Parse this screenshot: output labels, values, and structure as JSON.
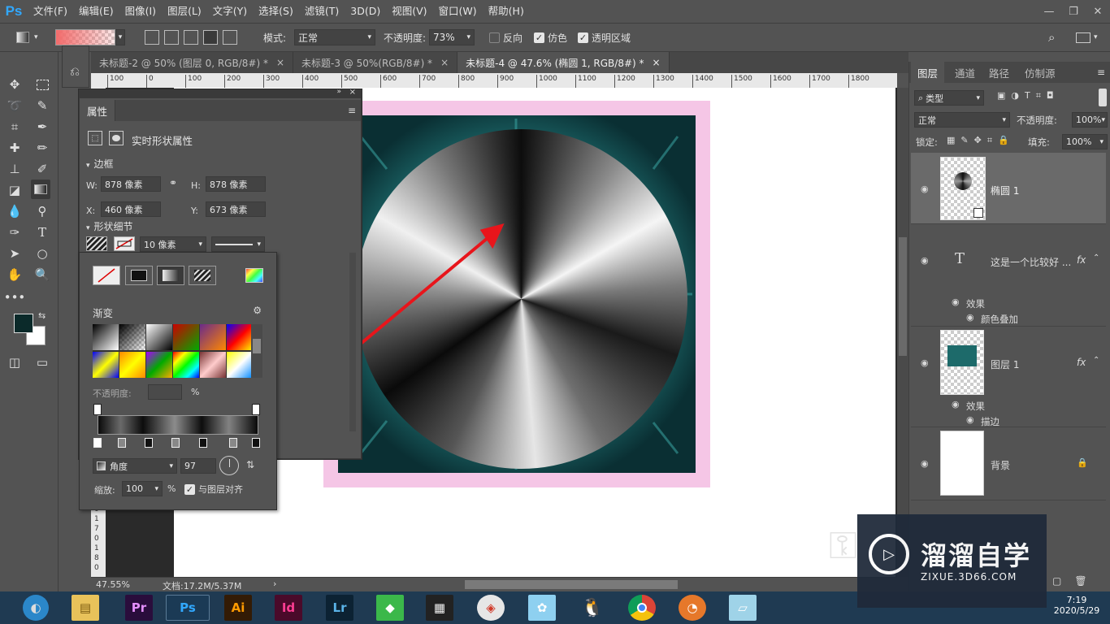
{
  "app": {
    "logo": "Ps"
  },
  "menu": [
    "文件(F)",
    "编辑(E)",
    "图像(I)",
    "图层(L)",
    "文字(Y)",
    "选择(S)",
    "滤镜(T)",
    "3D(D)",
    "视图(V)",
    "窗口(W)",
    "帮助(H)"
  ],
  "window_controls": {
    "minimize": "—",
    "restore": "❐",
    "close": "✕"
  },
  "options": {
    "mode_label": "模式:",
    "mode_value": "正常",
    "opacity_label": "不透明度:",
    "opacity_value": "73%",
    "reverse_label": "反向",
    "dither_label": "仿色",
    "transparency_label": "透明区域",
    "reverse_checked": false,
    "dither_checked": true,
    "transparency_checked": true
  },
  "tabs": [
    {
      "label": "未标题-2 @ 50% (图层 0, RGB/8#) *",
      "active": false
    },
    {
      "label": "未标题-3 @ 50%(RGB/8#) *",
      "active": false
    },
    {
      "label": "未标题-4 @ 47.6% (椭圆 1, RGB/8#) *",
      "active": true
    }
  ],
  "ruler_ticks": [
    "100",
    "0",
    "100",
    "200",
    "300",
    "400",
    "500",
    "600",
    "700",
    "800",
    "900",
    "1000",
    "1100",
    "1200",
    "1300",
    "1400",
    "1500",
    "1600",
    "1700",
    "1800"
  ],
  "ruler_v_ticks": [
    "0",
    "1",
    "7",
    "0",
    "1",
    "8",
    "0"
  ],
  "properties": {
    "tab": "属性",
    "heading": "实时形状属性",
    "section_bounds": "边框",
    "w_label": "W:",
    "w_value": "878 像素",
    "h_label": "H:",
    "h_value": "878 像素",
    "x_label": "X:",
    "x_value": "460 像素",
    "y_label": "Y:",
    "y_value": "673 像素",
    "section_shape": "形状细节",
    "stroke_width": "10 像素"
  },
  "gradient_picker": {
    "title": "渐变",
    "opacity_label": "不透明度:",
    "percent": "%",
    "angle_type": "角度",
    "angle_value": "97",
    "scale_label": "缩放:",
    "scale_value": "100",
    "align_label": "与图层对齐",
    "align_checked": true
  },
  "layers_panel": {
    "tabs": [
      "图层",
      "通道",
      "路径",
      "仿制源"
    ],
    "filter": "类型",
    "blend": "正常",
    "opacity_label": "不透明度:",
    "opacity_value": "100%",
    "lock_label": "锁定:",
    "fill_label": "填充:",
    "fill_value": "100%",
    "layers": [
      {
        "name": "椭圆 1"
      },
      {
        "name": "这是一个比较好 ...",
        "fx": "fx",
        "effects_label": "效果",
        "effect": "颜色叠加"
      },
      {
        "name": "图层 1",
        "fx": "fx",
        "effects_label": "效果",
        "effect": "描边"
      },
      {
        "name": "背景"
      }
    ]
  },
  "status": {
    "zoom": "47.55%",
    "doc": "文档:17.2M/5.37M"
  },
  "taskbar": {
    "apps": [
      "Pr",
      "Ps",
      "Ai",
      "Id",
      "Lr"
    ],
    "time": "7:19",
    "date": "2020/5/29"
  },
  "watermark": {
    "title": "溜溜自学",
    "url": "ZIXUE.3D66.COM"
  },
  "colors": {
    "accent": "#31a8ff",
    "pink_border": "#f5c6e6",
    "teal": "#1a6b6b",
    "arrow": "#e8151b",
    "foreground": "#0b2a2a"
  }
}
